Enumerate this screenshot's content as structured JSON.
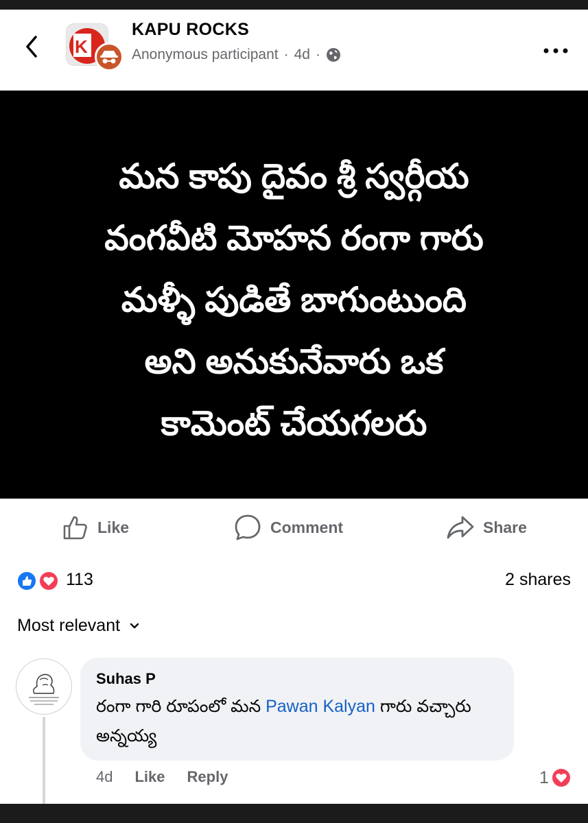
{
  "header": {
    "group_name": "KAPU ROCKS",
    "author": "Anonymous participant",
    "separator": "·",
    "time": "4d",
    "privacy_icon": "globe-icon",
    "back_icon": "chevron-left-icon",
    "more_icon": "more-horizontal-icon"
  },
  "post": {
    "lines": [
      "మన కాపు దైవం శ్రీ స్వర్గీయ",
      "వంగవీటి మోహన రంగా గారు",
      "మళ్ళీ పుడితే బాగుంటుంది",
      "అని అనుకునేవారు ఒక",
      "కామెంట్ చేయగలరు"
    ],
    "background": "#000000",
    "text_color": "#ffffff"
  },
  "actions": {
    "like": "Like",
    "comment": "Comment",
    "share": "Share"
  },
  "stats": {
    "reaction_count": "113",
    "shares": "2 shares",
    "like_color": "#1877f2",
    "love_color": "#f33e58"
  },
  "comments_sort": "Most relevant",
  "comment": {
    "name": "Suhas P",
    "text_before": "రంగా గారి రూపంలో మన ",
    "mention": "Pawan Kalyan",
    "text_after": " గారు వచ్చారు అన్నయ్య",
    "time": "4d",
    "like": "Like",
    "reply": "Reply",
    "reaction_count": "1"
  }
}
